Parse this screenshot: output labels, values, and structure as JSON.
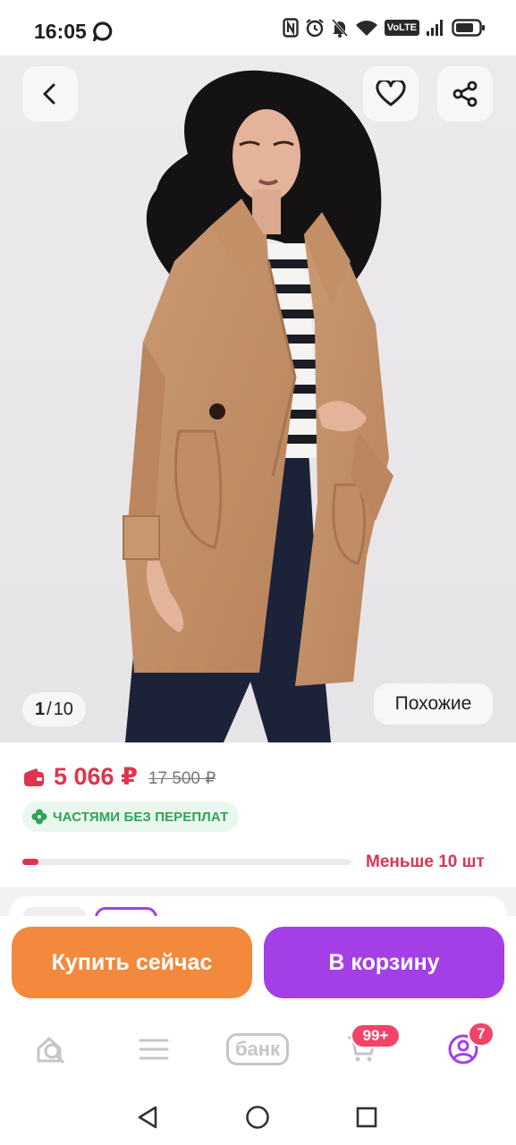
{
  "status_bar": {
    "time": "16:05",
    "volte": "VoLTE",
    "icons": [
      "chat-bubble-icon",
      "nfc-icon",
      "alarm-icon",
      "mute-icon",
      "wifi-icon",
      "signal-icon",
      "battery-icon"
    ]
  },
  "gallery": {
    "current": "1",
    "separator": "/",
    "total": "10",
    "similar_label": "Похожие",
    "icons": [
      "back-arrow-icon",
      "heart-icon",
      "share-icon"
    ]
  },
  "product": {
    "price": "5 066 ₽",
    "old_price": "17 500 ₽",
    "installment_label": "ЧАСТЯМИ БЕЗ ПЕРЕПЛАТ",
    "stock_label": "Меньше 10 шт",
    "stock_level_fraction": 0.05
  },
  "actions": {
    "buy_now": "Купить сейчас",
    "add_to_cart": "В корзину"
  },
  "bottom_nav": {
    "bank_label": "банк",
    "cart_badge": "99+",
    "profile_badge": "7",
    "items": [
      "home-icon",
      "catalog-icon",
      "bank-icon",
      "cart-icon",
      "profile-icon"
    ]
  },
  "colors": {
    "price_red": "#e0334d",
    "installment_green": "#2fa35a",
    "buy_orange": "#f2893d",
    "cart_purple": "#a43fe8",
    "badge_pink": "#f24468"
  }
}
